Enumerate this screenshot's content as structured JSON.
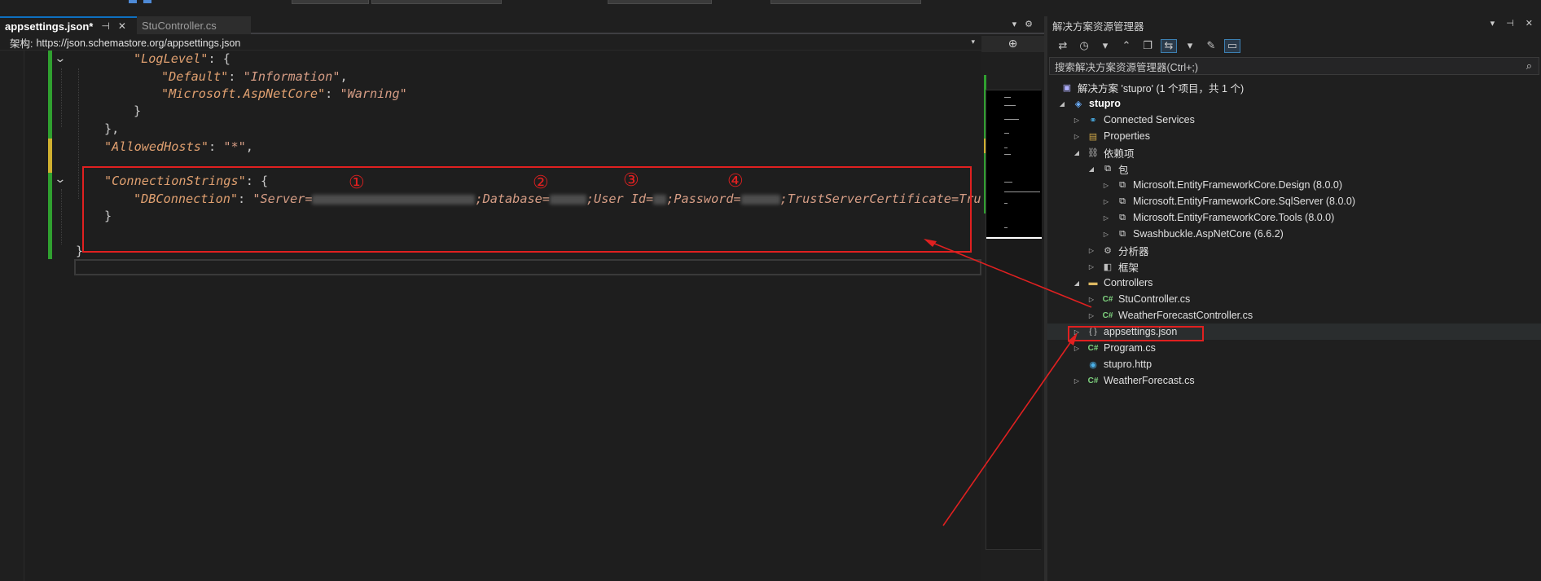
{
  "editor": {
    "tabs": [
      {
        "label": "appsettings.json*",
        "pin": "⊣",
        "close": "✕"
      },
      {
        "label": "StuController.cs"
      }
    ],
    "tabbar_icons": {
      "dropdown": "▾",
      "settings": "⚙"
    },
    "schema": {
      "label": "架构:",
      "url": "https://json.schemastore.org/appsettings.json",
      "dropdown": "▾"
    },
    "code": {
      "line1_key": "\"LogLevel\"",
      "line1_rest": ": {",
      "line2_key": "\"Default\"",
      "line2_sep": ": ",
      "line2_val": "\"Information\"",
      "line2_end": ",",
      "line3_key": "\"Microsoft.AspNetCore\"",
      "line3_sep": ": ",
      "line3_val": "\"Warning\"",
      "line4": "}",
      "line5": "},",
      "line6_key": "\"AllowedHosts\"",
      "line6_sep": ": ",
      "line6_val": "\"*\"",
      "line6_end": ",",
      "line7_key": "\"ConnectionStrings\"",
      "line7_rest": ": {",
      "line8_key": "\"DBConnection\"",
      "line8_sep": ": ",
      "line8_seg1": "\"Server=",
      "line8_seg2": ";Database=",
      "line8_seg3": ";User Id=",
      "line8_seg4": ";Password=",
      "line8_seg5": ";TrustServerCertificate=True\"",
      "line9": "}",
      "line10": "}"
    },
    "annotations": [
      "①",
      "②",
      "③",
      "④"
    ],
    "minimap_top_icon": "⊕"
  },
  "solution_explorer": {
    "title": "解决方案资源管理器",
    "title_icons": {
      "dropdown": "▾",
      "pin": "⊣",
      "close": "✕"
    },
    "search_placeholder": "搜索解决方案资源管理器(Ctrl+;)",
    "search_icon": "⌕",
    "tree": [
      {
        "label": "解决方案 'stupro' (1 个项目，共 1 个)"
      },
      {
        "label": "stupro"
      },
      {
        "label": "Connected Services"
      },
      {
        "label": "Properties"
      },
      {
        "label": "依赖项"
      },
      {
        "label": "包"
      },
      {
        "label": "Microsoft.EntityFrameworkCore.Design (8.0.0)"
      },
      {
        "label": "Microsoft.EntityFrameworkCore.SqlServer (8.0.0)"
      },
      {
        "label": "Microsoft.EntityFrameworkCore.Tools (8.0.0)"
      },
      {
        "label": "Swashbuckle.AspNetCore (6.6.2)"
      },
      {
        "label": "分析器"
      },
      {
        "label": "框架"
      },
      {
        "label": "Controllers"
      },
      {
        "label": "StuController.cs"
      },
      {
        "label": "WeatherForecastController.cs"
      },
      {
        "label": "appsettings.json"
      },
      {
        "label": "Program.cs"
      },
      {
        "label": "stupro.http"
      },
      {
        "label": "WeatherForecast.cs"
      }
    ]
  },
  "colors": {
    "accent_red": "#e02020",
    "string": "#d69d85",
    "change_green": "#30a030"
  }
}
